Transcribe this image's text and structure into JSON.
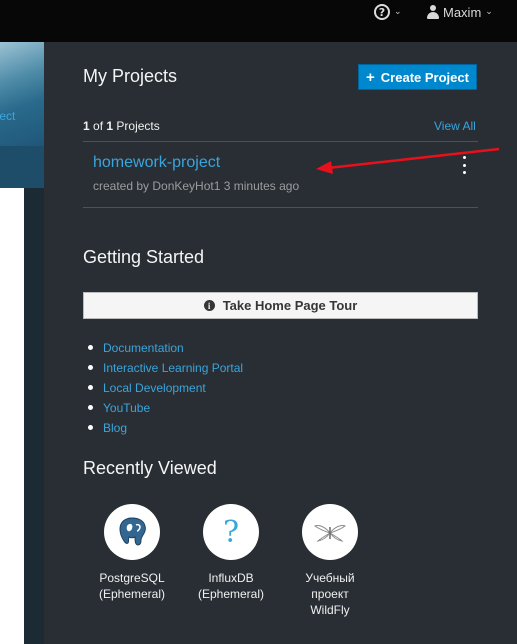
{
  "header": {
    "help_caret": "⌄",
    "username": "Maxim",
    "user_caret": "⌄"
  },
  "background": {
    "hero_link_text": "oject",
    "panel_text": "-"
  },
  "my_projects": {
    "title": "My Projects",
    "create_button": "Create Project",
    "count_shown": "1",
    "count_of": "of",
    "count_total": "1",
    "count_label": "Projects",
    "view_all": "View All",
    "projects": [
      {
        "name": "homework-project",
        "meta": "created by DonKeyHot1 3 minutes ago"
      }
    ]
  },
  "getting_started": {
    "title": "Getting Started",
    "tour_button": "Take Home Page Tour",
    "links": [
      "Documentation",
      "Interactive Learning Portal",
      "Local Development",
      "YouTube",
      "Blog"
    ]
  },
  "recently_viewed": {
    "title": "Recently Viewed",
    "items": [
      {
        "label_line1": "PostgreSQL",
        "label_line2": "(Ephemeral)",
        "label_line3": "",
        "icon": "postgresql-icon"
      },
      {
        "label_line1": "InfluxDB",
        "label_line2": "(Ephemeral)",
        "label_line3": "",
        "icon": "question-icon"
      },
      {
        "label_line1": "Учебный",
        "label_line2": "проект",
        "label_line3": "WildFly",
        "icon": "wildfly-icon"
      }
    ]
  },
  "colors": {
    "accent": "#39a5dc",
    "primary_button": "#0088ce",
    "panel_bg": "#292e34",
    "annotation": "#e8101b"
  }
}
